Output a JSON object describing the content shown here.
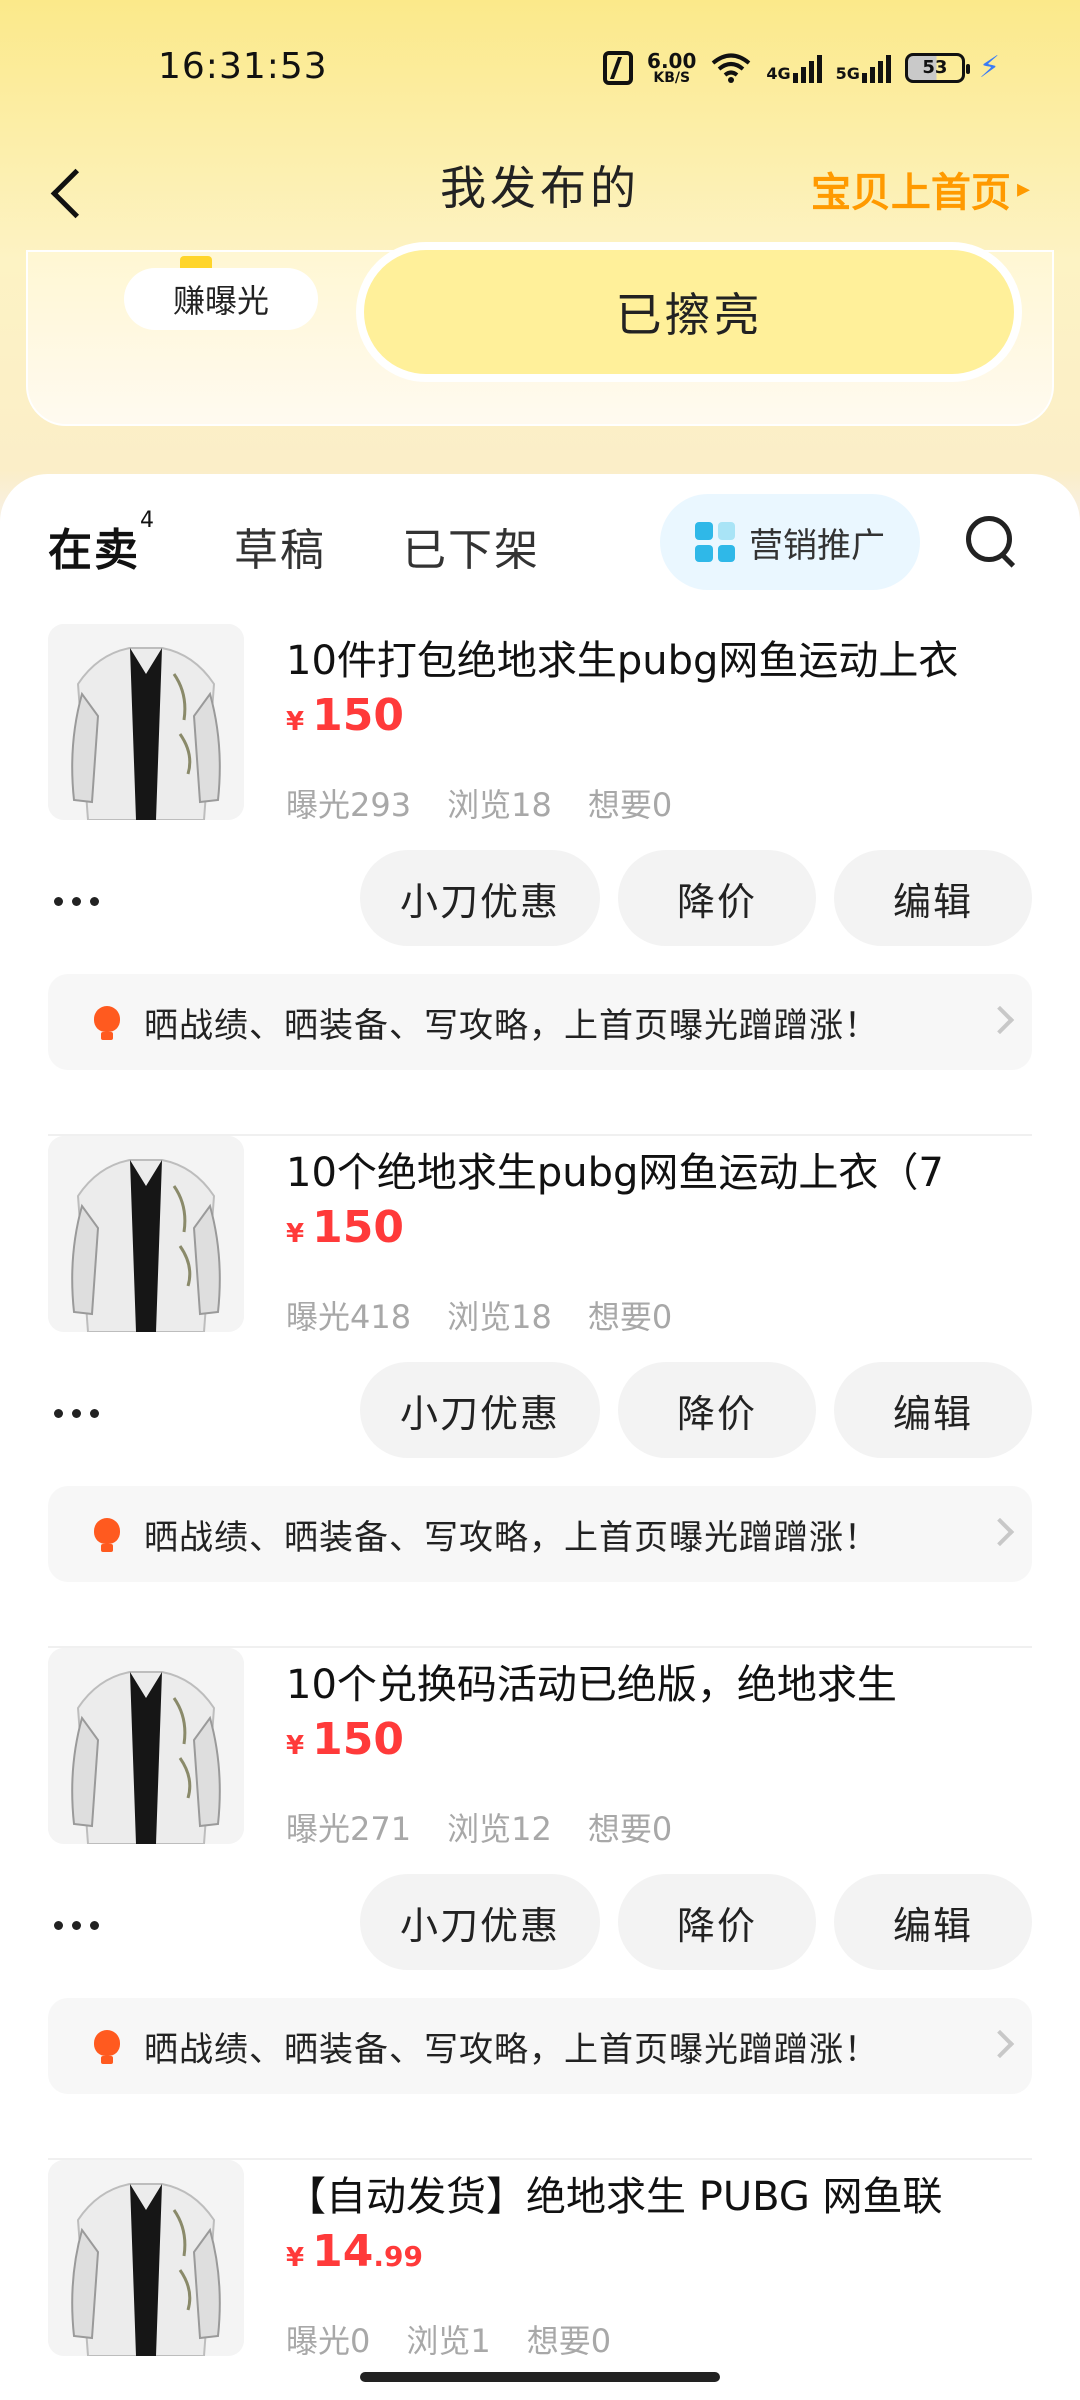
{
  "status_bar": {
    "time": "16:31:53",
    "net_speed_value": "6.00",
    "net_speed_unit": "KB/S",
    "network_1": "4G",
    "network_2": "5G",
    "battery": "53"
  },
  "nav": {
    "title": "我发布的",
    "right_link": "宝贝上首页"
  },
  "promo": {
    "earn_label": "赚曝光",
    "polished_label": "已擦亮"
  },
  "tabs": [
    {
      "label": "在卖",
      "count": "4",
      "active": true
    },
    {
      "label": "草稿",
      "active": false
    },
    {
      "label": "已下架",
      "active": false
    }
  ],
  "marketing_label": "营销推广",
  "items": [
    {
      "title": "10件打包绝地求生pubg网鱼运动上衣",
      "price_symbol": "¥",
      "price_int": "150",
      "price_dec": "",
      "exposure": "曝光293",
      "views": "浏览18",
      "wants": "想要0",
      "actions": [
        "小刀优惠",
        "降价",
        "编辑"
      ],
      "tip": "晒战绩、晒装备、写攻略，上首页曝光蹭蹭涨！"
    },
    {
      "title": "10个绝地求生pubg网鱼运动上衣（7",
      "price_symbol": "¥",
      "price_int": "150",
      "price_dec": "",
      "exposure": "曝光418",
      "views": "浏览18",
      "wants": "想要0",
      "actions": [
        "小刀优惠",
        "降价",
        "编辑"
      ],
      "tip": "晒战绩、晒装备、写攻略，上首页曝光蹭蹭涨！"
    },
    {
      "title": "10个兑换码活动已绝版，绝地求生",
      "price_symbol": "¥",
      "price_int": "150",
      "price_dec": "",
      "exposure": "曝光271",
      "views": "浏览12",
      "wants": "想要0",
      "actions": [
        "小刀优惠",
        "降价",
        "编辑"
      ],
      "tip": "晒战绩、晒装备、写攻略，上首页曝光蹭蹭涨！"
    },
    {
      "title": "【自动发货】绝地求生 PUBG 网鱼联",
      "price_symbol": "¥",
      "price_int": "14",
      "price_dec": ".99",
      "exposure": "曝光0",
      "views": "浏览1",
      "wants": "想要0"
    }
  ]
}
